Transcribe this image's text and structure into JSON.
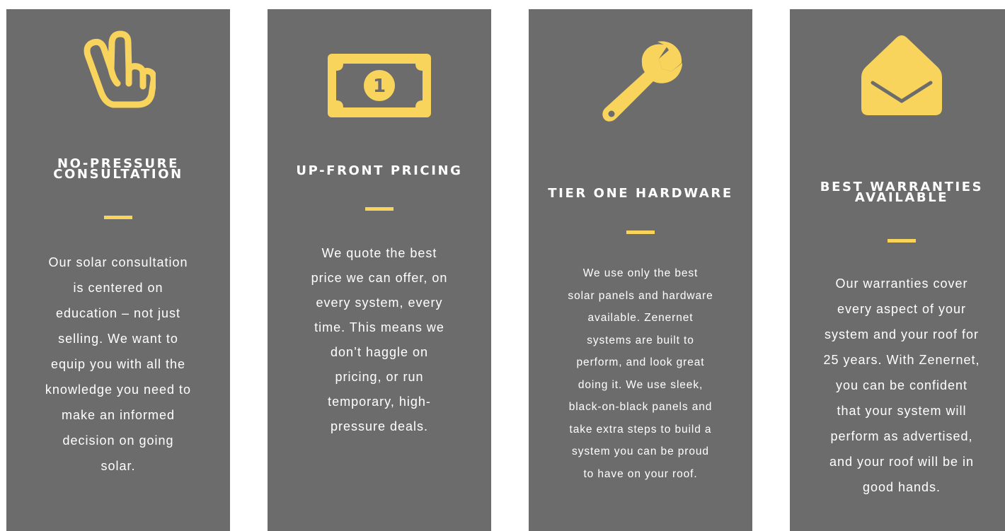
{
  "colors": {
    "card_background": "#6c6c6c",
    "accent": "#f8d45c",
    "text": "#ffffff"
  },
  "cards": [
    {
      "icon": "peace-hand-icon",
      "title_lines": [
        "NO-PRESSURE",
        "CONSULTATION"
      ],
      "body_lines": [
        "Our solar consultation",
        "is centered on",
        "education – not just",
        "selling. We want to",
        "equip you with all the",
        "knowledge you need to",
        "make an informed",
        "decision on going",
        "solar."
      ]
    },
    {
      "icon": "dollar-bill-icon",
      "bill_value": "1",
      "title_lines": [
        "UP-FRONT PRICING"
      ],
      "body_lines": [
        "We quote the best",
        "price we can offer, on",
        "every system, every",
        "time. This means we",
        "don’t haggle on",
        "pricing, or run",
        "temporary, high-",
        "pressure deals."
      ]
    },
    {
      "icon": "wrench-icon",
      "title_lines": [
        "TIER ONE HARDWARE"
      ],
      "body_lines": [
        "We use only the best",
        "solar panels and hardware",
        "available. Zenernet",
        "systems are built to",
        "perform, and look great",
        "doing it. We use sleek,",
        "black-on-black panels and",
        "take extra steps to build a",
        "system you can be proud",
        "to have on your roof."
      ]
    },
    {
      "icon": "open-envelope-icon",
      "title_lines": [
        "BEST WARRANTIES",
        "AVAILABLE"
      ],
      "body_lines": [
        "Our warranties cover",
        "every aspect of your",
        "system and your roof for",
        "25 years. With Zenernet,",
        "you can be confident",
        "that your system will",
        "perform as advertised,",
        "and your roof will be in",
        "good hands."
      ]
    }
  ]
}
